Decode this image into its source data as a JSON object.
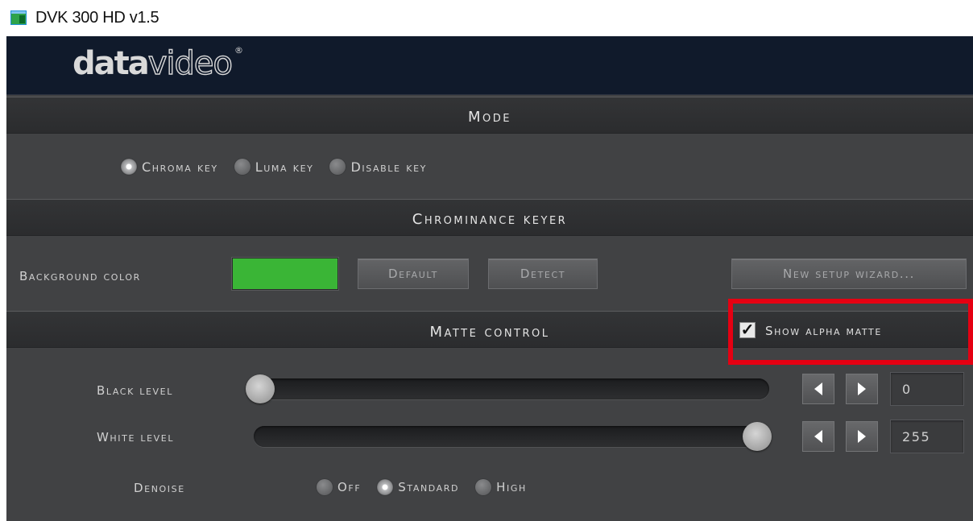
{
  "window": {
    "title": "DVK 300 HD v1.5",
    "icon": "app-window-icon"
  },
  "header": {
    "logo_text_bold": "data",
    "logo_text_outline": "video",
    "logo_reg": "®"
  },
  "mode": {
    "title": "Mode",
    "options": [
      {
        "label": "Chroma key",
        "selected": true
      },
      {
        "label": "Luma key",
        "selected": false
      },
      {
        "label": "Disable key",
        "selected": false
      }
    ]
  },
  "chrominance": {
    "title": "Chrominance keyer",
    "background_color_label": "Background color",
    "background_color": "#3ab536",
    "default_label": "Default",
    "detect_label": "Detect",
    "wizard_label": "New setup wizard..."
  },
  "matte": {
    "title": "Matte control",
    "show_alpha_label": "Show alpha matte",
    "show_alpha_checked": true,
    "black_level": {
      "label": "Black level",
      "value": "0",
      "fraction": 0
    },
    "white_level": {
      "label": "White level",
      "value": "255",
      "fraction": 1
    },
    "denoise": {
      "label": "Denoise",
      "options": [
        {
          "label": "Off",
          "selected": false
        },
        {
          "label": "Standard",
          "selected": true
        },
        {
          "label": "High",
          "selected": false
        }
      ]
    }
  },
  "colors": {
    "panel": "#414244",
    "header": "#101a2b",
    "highlight": "#e50012",
    "swatch": "#3ab536"
  }
}
